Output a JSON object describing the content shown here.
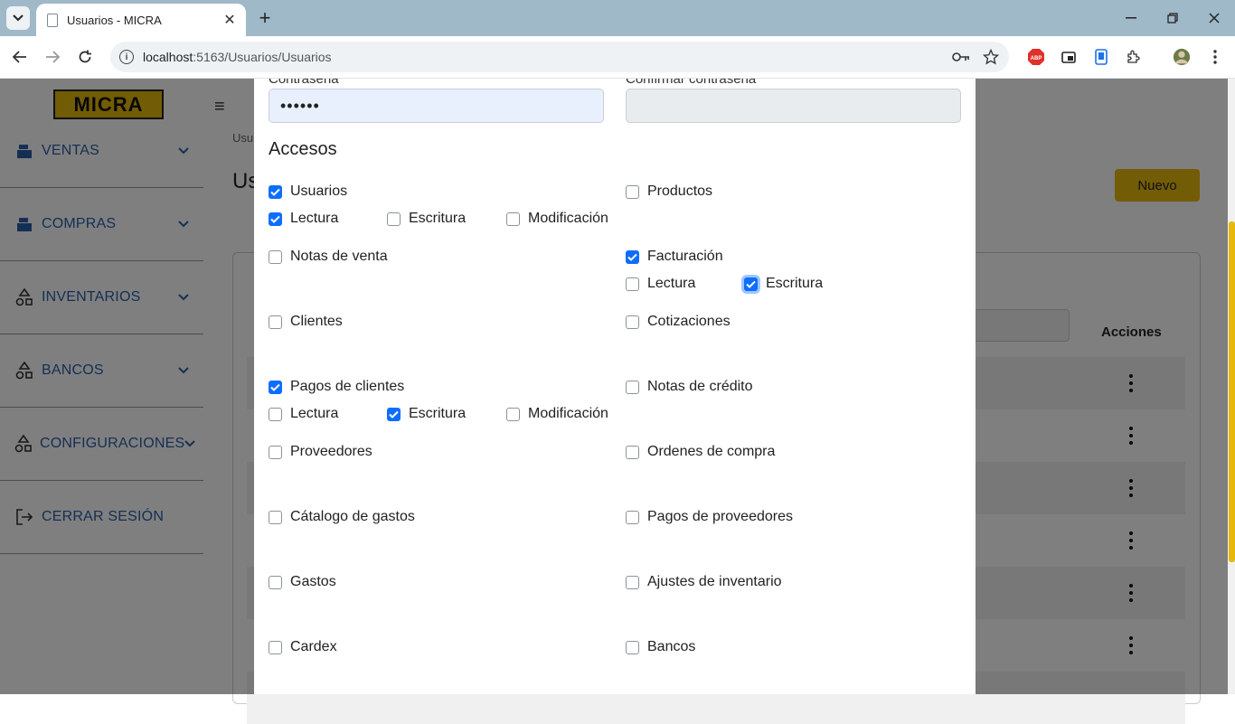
{
  "browser": {
    "tab_title": "Usuarios - MICRA",
    "url_host": "localhost",
    "url_path": ":5163/Usuarios/Usuarios"
  },
  "app": {
    "logo_text": "MICRA",
    "sidebar": [
      {
        "label": "VENTAS",
        "icon": "register-icon"
      },
      {
        "label": "COMPRAS",
        "icon": "register-icon"
      },
      {
        "label": "INVENTARIOS",
        "icon": "shapes-icon"
      },
      {
        "label": "BANCOS",
        "icon": "shapes-icon"
      },
      {
        "label": "CONFIGURACIONES",
        "icon": "shapes-icon"
      },
      {
        "label": "CERRAR SESIÓN",
        "icon": "logout-icon"
      }
    ],
    "breadcrumb": "Usu",
    "page_title": "Us",
    "new_button": "Nuevo",
    "table": {
      "actions_header": "Acciones"
    }
  },
  "modal": {
    "password_label": "Contraseña",
    "password_value": "••••••",
    "confirm_label": "Confirmar contraseña",
    "confirm_value": "",
    "accesos_title": "Accesos",
    "checks": {
      "usuarios": {
        "label": "Usuarios",
        "checked": true
      },
      "usuarios_lectura": {
        "label": "Lectura",
        "checked": true
      },
      "usuarios_escritura": {
        "label": "Escritura",
        "checked": false
      },
      "usuarios_modificacion": {
        "label": "Modificación",
        "checked": false
      },
      "productos": {
        "label": "Productos",
        "checked": false
      },
      "notas_venta": {
        "label": "Notas de venta",
        "checked": false
      },
      "facturacion": {
        "label": "Facturación",
        "checked": true
      },
      "facturacion_lectura": {
        "label": "Lectura",
        "checked": false
      },
      "facturacion_escritura": {
        "label": "Escritura",
        "checked": true
      },
      "clientes": {
        "label": "Clientes",
        "checked": false
      },
      "cotizaciones": {
        "label": "Cotizaciones",
        "checked": false
      },
      "pagos_clientes": {
        "label": "Pagos de clientes",
        "checked": true
      },
      "pagos_clientes_lectura": {
        "label": "Lectura",
        "checked": false
      },
      "pagos_clientes_escritura": {
        "label": "Escritura",
        "checked": true
      },
      "pagos_clientes_modificacion": {
        "label": "Modificación",
        "checked": false
      },
      "notas_credito": {
        "label": "Notas de crédito",
        "checked": false
      },
      "proveedores": {
        "label": "Proveedores",
        "checked": false
      },
      "ordenes_compra": {
        "label": "Ordenes de compra",
        "checked": false
      },
      "catalogo_gastos": {
        "label": "Cátalogo de gastos",
        "checked": false
      },
      "pagos_proveedores": {
        "label": "Pagos de proveedores",
        "checked": false
      },
      "gastos": {
        "label": "Gastos",
        "checked": false
      },
      "ajustes_inventario": {
        "label": "Ajustes de inventario",
        "checked": false
      },
      "cardex": {
        "label": "Cardex",
        "checked": false
      },
      "bancos": {
        "label": "Bancos",
        "checked": false
      }
    }
  }
}
